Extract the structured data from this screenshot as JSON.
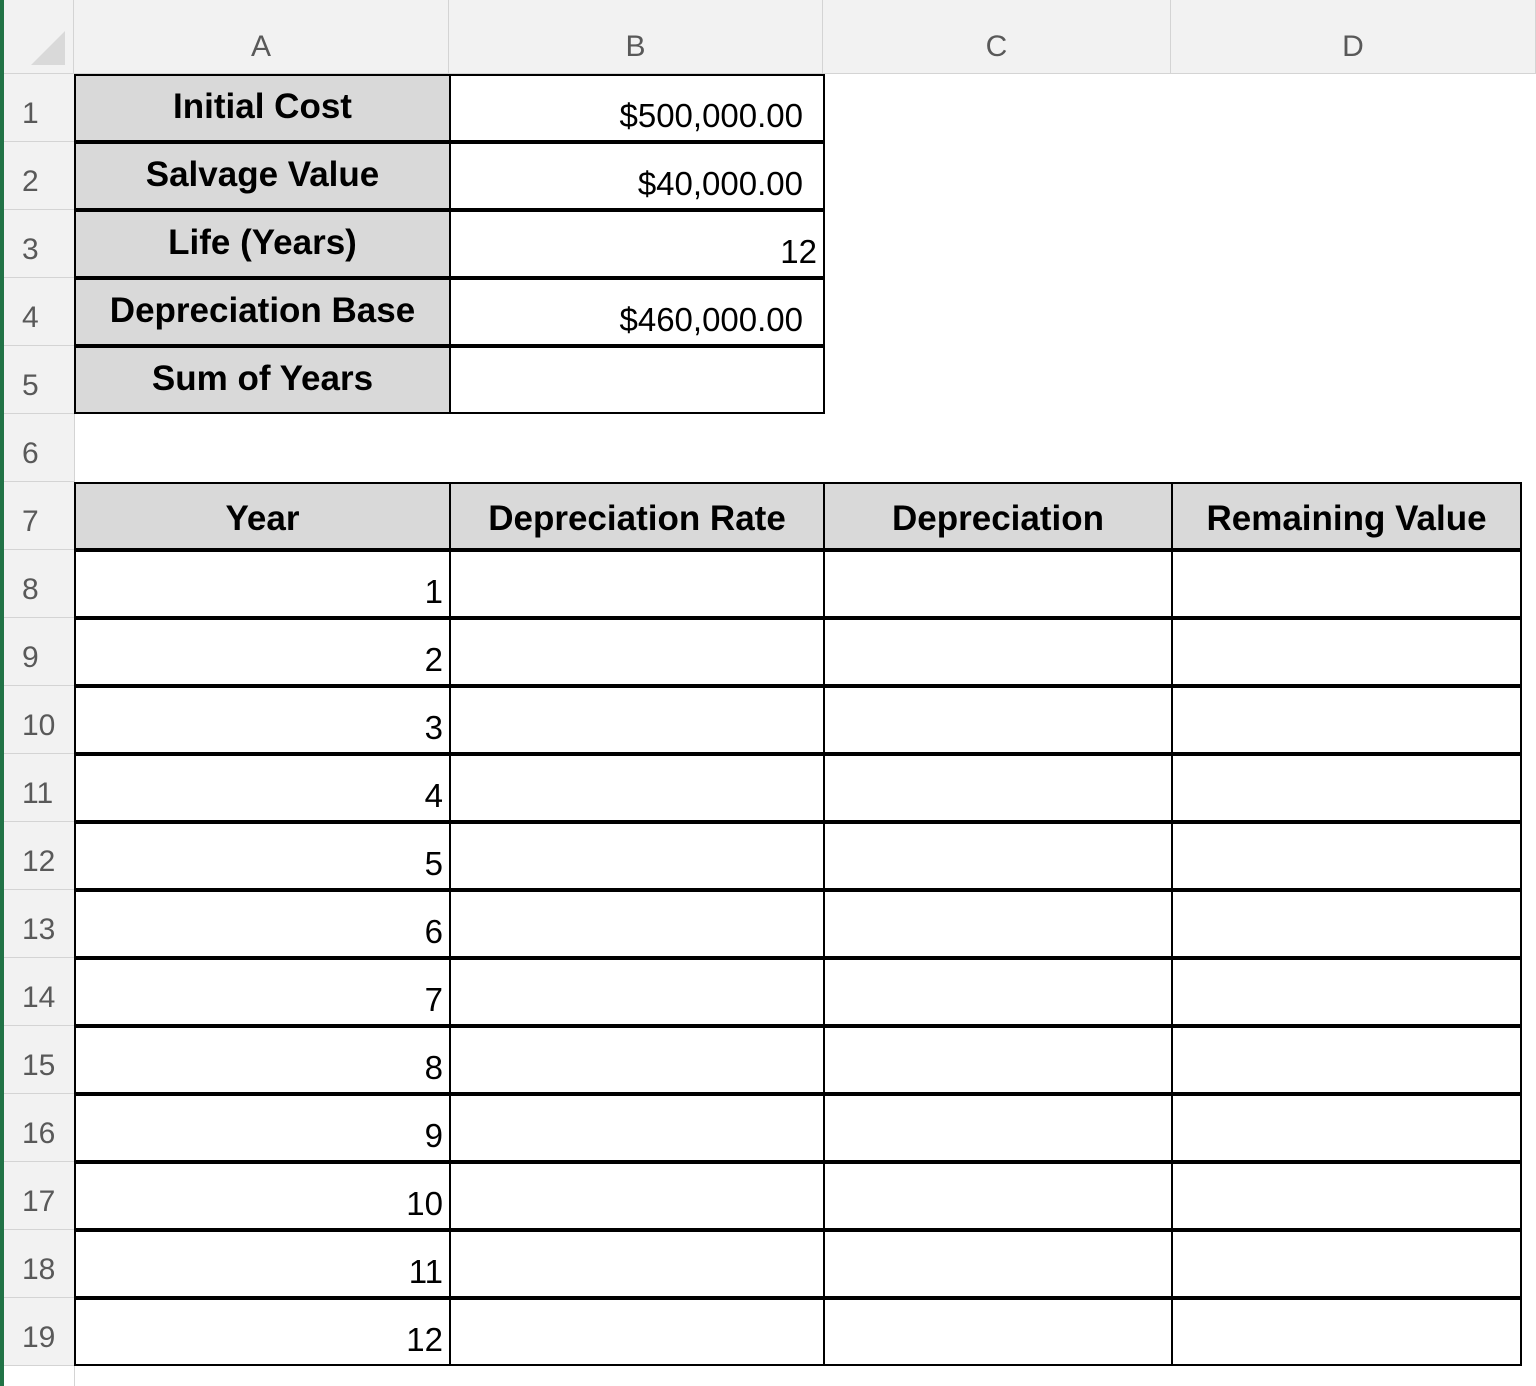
{
  "columns": [
    "A",
    "B",
    "C",
    "D"
  ],
  "rows": [
    "1",
    "2",
    "3",
    "4",
    "5",
    "6",
    "7",
    "8",
    "9",
    "10",
    "11",
    "12",
    "13",
    "14",
    "15",
    "16",
    "17",
    "18",
    "19"
  ],
  "inputs": [
    {
      "label": "Initial Cost",
      "value": "$500,000.00"
    },
    {
      "label": "Salvage Value",
      "value": "$40,000.00"
    },
    {
      "label": "Life (Years)",
      "value": "12"
    },
    {
      "label": "Depreciation Base",
      "value": "$460,000.00"
    },
    {
      "label": "Sum of Years",
      "value": ""
    }
  ],
  "table": {
    "headers": [
      "Year",
      "Depreciation Rate",
      "Depreciation",
      "Remaining Value"
    ],
    "years": [
      "1",
      "2",
      "3",
      "4",
      "5",
      "6",
      "7",
      "8",
      "9",
      "10",
      "11",
      "12"
    ]
  }
}
